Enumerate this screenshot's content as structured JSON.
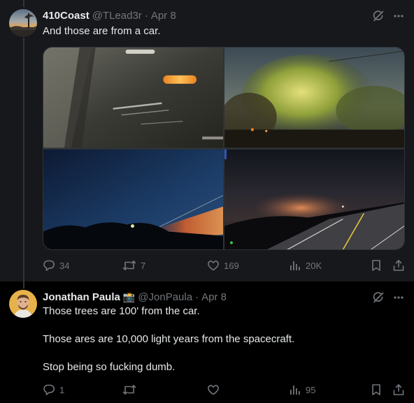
{
  "tweets": [
    {
      "display_name": "410Coast",
      "handle": "@TLead3r",
      "separator": "·",
      "date": "Apr 8",
      "text": "And those are from a car.",
      "media": [
        {
          "icon": "blurred-car-interior-photo"
        },
        {
          "icon": "blurred-trees-photo"
        },
        {
          "icon": "night-sky-motion-photo"
        },
        {
          "icon": "night-road-lights-photo"
        }
      ],
      "actions": {
        "replies": "34",
        "reposts": "7",
        "likes": "169",
        "views": "20K"
      }
    },
    {
      "display_name": "Jonathan Paula",
      "display_emoji": "📸",
      "handle": "@JonPaula",
      "separator": "·",
      "date": "Apr 8",
      "paragraphs": [
        "Those trees are 100' from the car.",
        "Those ares are 10,000 light years from the spacecraft.",
        "Stop being so fucking dumb."
      ],
      "actions": {
        "replies": "1",
        "reposts": "",
        "likes": "",
        "views": "95"
      }
    }
  ],
  "colors": {
    "background_dark": "#16181c",
    "background_black": "#000000",
    "text_primary": "#e7e9ea",
    "text_secondary": "#71767b",
    "verified_gold": "#e2b719"
  },
  "icons": {
    "grok": "grok-icon",
    "more": "more-icon",
    "reply": "reply-icon",
    "repost": "repost-icon",
    "like": "like-icon",
    "views": "views-icon",
    "bookmark": "bookmark-icon",
    "share": "share-icon"
  }
}
